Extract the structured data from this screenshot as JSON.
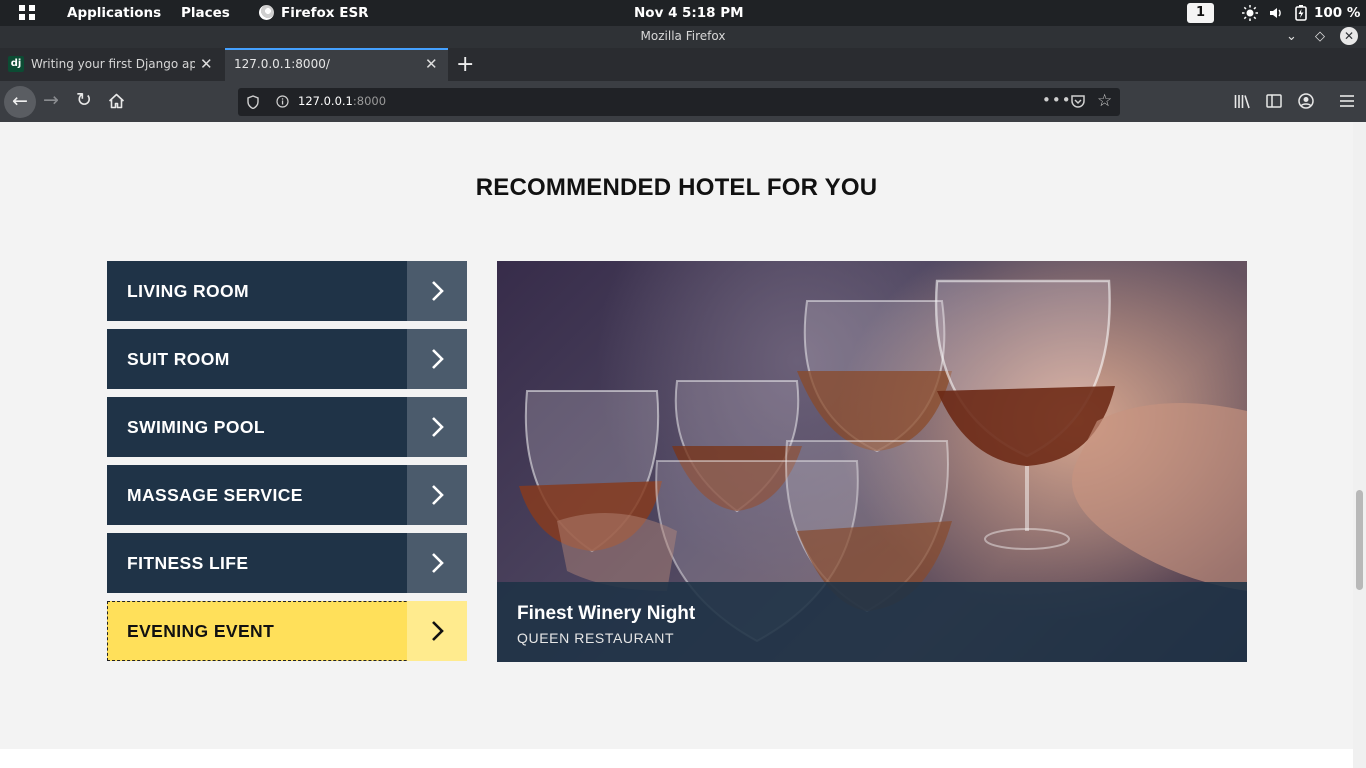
{
  "system_bar": {
    "applications": "Applications",
    "places": "Places",
    "firefox": "Firefox ESR",
    "date": "Nov 4",
    "time": "5:18 PM",
    "workspace": "1",
    "battery": "100 %"
  },
  "window": {
    "title": "Mozilla Firefox"
  },
  "tabs": [
    {
      "favicon": "dj",
      "label": "Writing your first Django app, pa"
    },
    {
      "label": "127.0.0.1:8000/"
    }
  ],
  "url": {
    "host": "127.0.0.1",
    "port": ":8000"
  },
  "page": {
    "heading": "RECOMMENDED HOTEL FOR YOU",
    "menu": [
      {
        "label": "LIVING ROOM"
      },
      {
        "label": "SUIT ROOM"
      },
      {
        "label": "SWIMING POOL"
      },
      {
        "label": "MASSAGE SERVICE"
      },
      {
        "label": "FITNESS LIFE"
      },
      {
        "label": "EVENING EVENT"
      }
    ],
    "active_menu_index": 5,
    "feature": {
      "title": "Finest Winery Night",
      "subtitle": "QUEEN RESTAURANT"
    }
  },
  "colors": {
    "menu_bg": "#1f3347",
    "menu_arrow_bg": "#4b5b6c",
    "active_bg": "#ffe05a",
    "caption_bg": "#1e3246"
  },
  "icons": [
    "apps-grid-icon",
    "firefox-icon",
    "brightness-icon",
    "volume-icon",
    "battery-icon",
    "back-arrow-icon",
    "forward-arrow-icon",
    "reload-icon",
    "home-icon",
    "shield-icon",
    "info-icon",
    "more-icon",
    "pocket-icon",
    "star-icon",
    "library-icon",
    "sidebar-icon",
    "account-icon",
    "hamburger-menu-icon",
    "chevron-right-icon"
  ]
}
